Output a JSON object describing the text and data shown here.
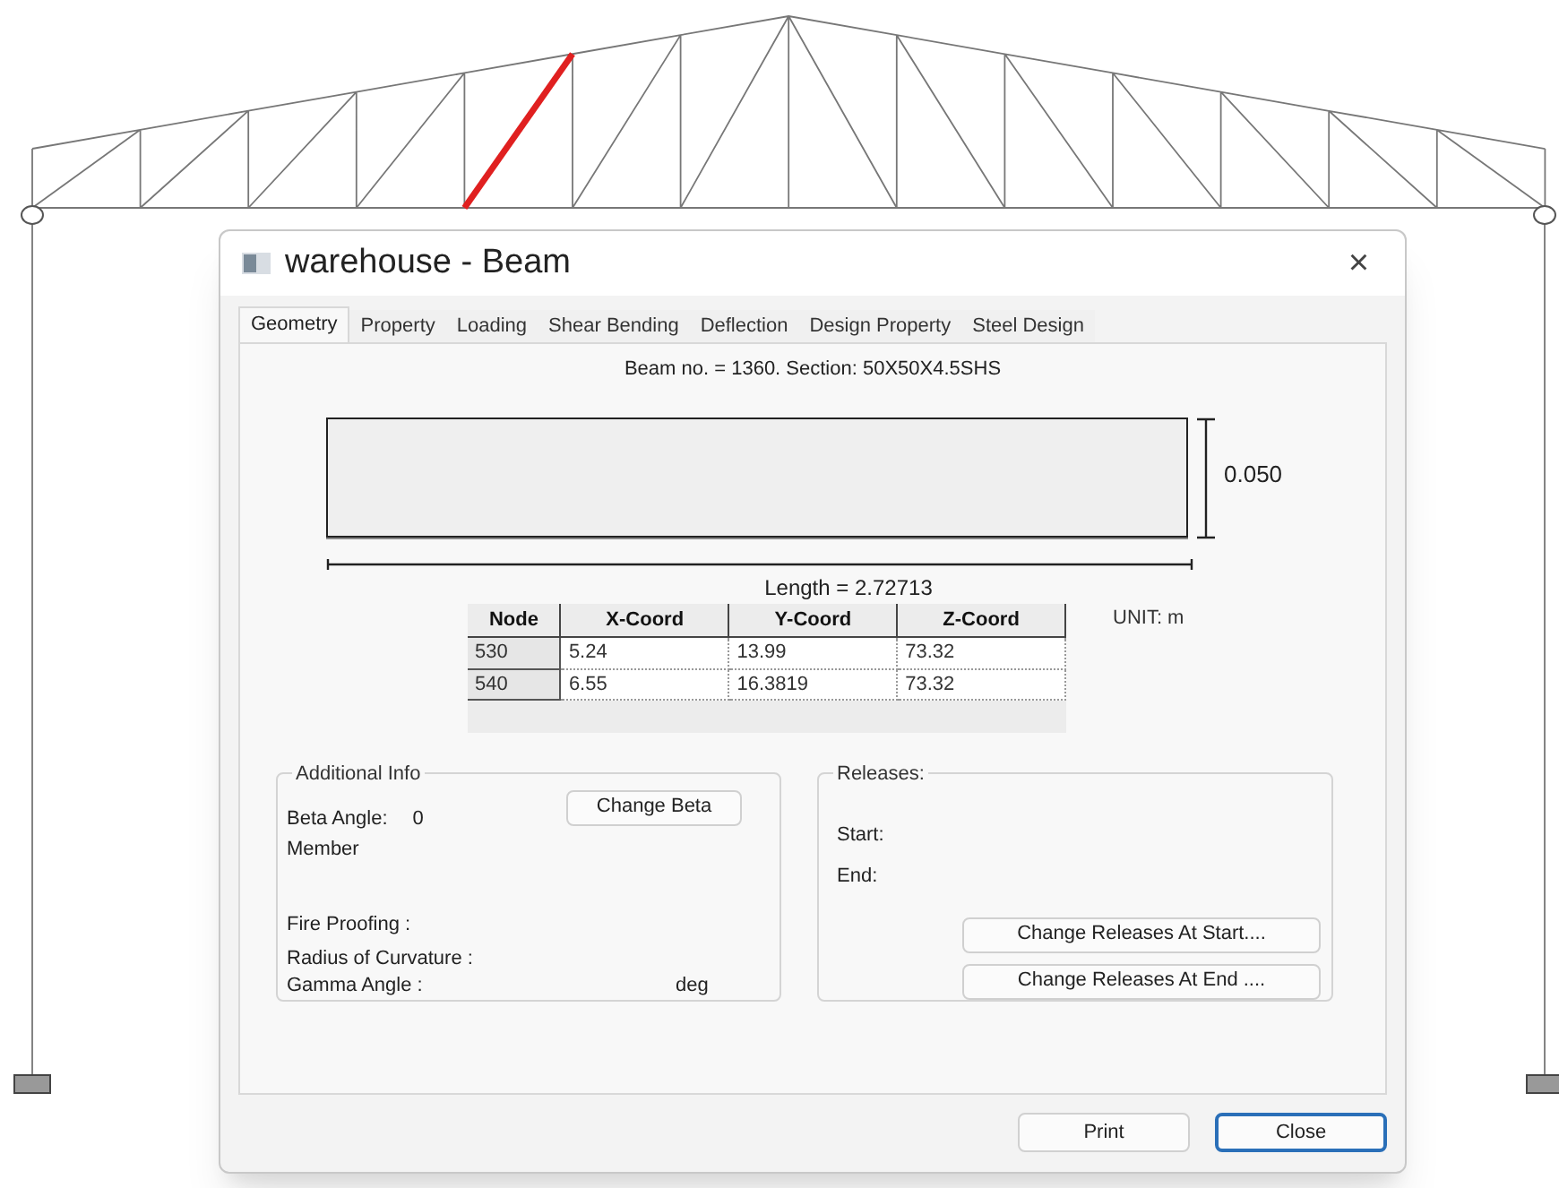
{
  "window": {
    "title": "warehouse - Beam",
    "close": "×"
  },
  "tabs": [
    {
      "label": "Geometry",
      "selected": true
    },
    {
      "label": "Property",
      "selected": false
    },
    {
      "label": "Loading",
      "selected": false
    },
    {
      "label": "Shear Bending",
      "selected": false
    },
    {
      "label": "Deflection",
      "selected": false
    },
    {
      "label": "Design Property",
      "selected": false
    },
    {
      "label": "Steel Design",
      "selected": false
    }
  ],
  "beam_info": "Beam no. = 1360. Section: 50X50X4.5SHS",
  "section_depth": "0.050",
  "length": "Length = 2.72713",
  "unit": "UNIT: m",
  "table": {
    "columns": [
      "Node",
      "X-Coord",
      "Y-Coord",
      "Z-Coord"
    ],
    "rows": [
      [
        "530",
        "5.24",
        "13.99",
        "73.32"
      ],
      [
        "540",
        "6.55",
        "16.3819",
        "73.32"
      ]
    ]
  },
  "additional_info": {
    "title": "Additional Info",
    "beta_label": "Beta Angle:",
    "beta_value": "0",
    "member": "Member",
    "change_beta": "Change Beta",
    "fire_proofing": "Fire Proofing :",
    "radius": "Radius of Curvature :",
    "gamma": "Gamma Angle :",
    "gamma_unit": "deg"
  },
  "releases": {
    "title": "Releases:",
    "start": "Start:",
    "end": "End:",
    "buttons": [
      "Change Releases At Start....",
      "Change Releases At End ...."
    ]
  },
  "footer_buttons": [
    {
      "label": "Print",
      "focused": false
    },
    {
      "label": "Close",
      "focused": true
    }
  ]
}
